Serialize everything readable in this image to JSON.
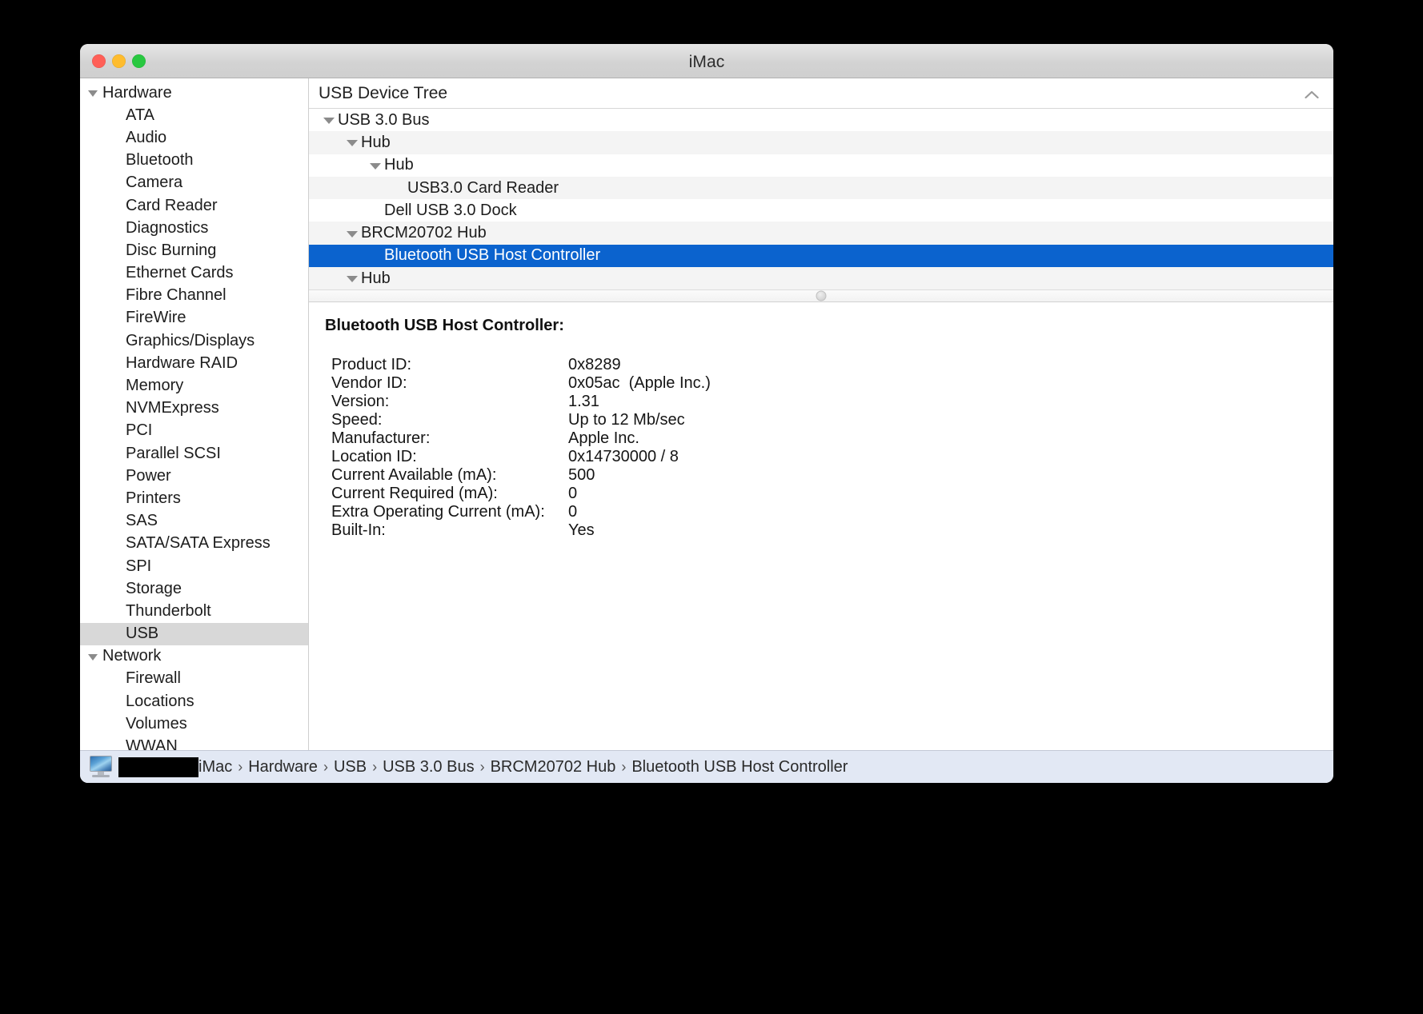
{
  "window": {
    "title": "iMac",
    "traffic_lights": [
      "close-button",
      "minimize-button",
      "zoom-button"
    ]
  },
  "sidebar": {
    "items": [
      {
        "label": "Hardware",
        "type": "group",
        "selected": false
      },
      {
        "label": "ATA",
        "type": "child",
        "selected": false
      },
      {
        "label": "Audio",
        "type": "child",
        "selected": false
      },
      {
        "label": "Bluetooth",
        "type": "child",
        "selected": false
      },
      {
        "label": "Camera",
        "type": "child",
        "selected": false
      },
      {
        "label": "Card Reader",
        "type": "child",
        "selected": false
      },
      {
        "label": "Diagnostics",
        "type": "child",
        "selected": false
      },
      {
        "label": "Disc Burning",
        "type": "child",
        "selected": false
      },
      {
        "label": "Ethernet Cards",
        "type": "child",
        "selected": false
      },
      {
        "label": "Fibre Channel",
        "type": "child",
        "selected": false
      },
      {
        "label": "FireWire",
        "type": "child",
        "selected": false
      },
      {
        "label": "Graphics/Displays",
        "type": "child",
        "selected": false
      },
      {
        "label": "Hardware RAID",
        "type": "child",
        "selected": false
      },
      {
        "label": "Memory",
        "type": "child",
        "selected": false
      },
      {
        "label": "NVMExpress",
        "type": "child",
        "selected": false
      },
      {
        "label": "PCI",
        "type": "child",
        "selected": false
      },
      {
        "label": "Parallel SCSI",
        "type": "child",
        "selected": false
      },
      {
        "label": "Power",
        "type": "child",
        "selected": false
      },
      {
        "label": "Printers",
        "type": "child",
        "selected": false
      },
      {
        "label": "SAS",
        "type": "child",
        "selected": false
      },
      {
        "label": "SATA/SATA Express",
        "type": "child",
        "selected": false
      },
      {
        "label": "SPI",
        "type": "child",
        "selected": false
      },
      {
        "label": "Storage",
        "type": "child",
        "selected": false
      },
      {
        "label": "Thunderbolt",
        "type": "child",
        "selected": false
      },
      {
        "label": "USB",
        "type": "child",
        "selected": true
      },
      {
        "label": "Network",
        "type": "group",
        "selected": false
      },
      {
        "label": "Firewall",
        "type": "child",
        "selected": false
      },
      {
        "label": "Locations",
        "type": "child",
        "selected": false
      },
      {
        "label": "Volumes",
        "type": "child",
        "selected": false
      },
      {
        "label": "WWAN",
        "type": "child",
        "selected": false
      }
    ]
  },
  "tree_panel": {
    "header_label": "USB Device Tree",
    "collapse_icon": "chevron-up-icon",
    "rows": [
      {
        "label": "USB 3.0 Bus",
        "depth": 0,
        "disclosure": true,
        "selected": false,
        "alt": false
      },
      {
        "label": "Hub",
        "depth": 1,
        "disclosure": true,
        "selected": false,
        "alt": true
      },
      {
        "label": "Hub",
        "depth": 2,
        "disclosure": true,
        "selected": false,
        "alt": false
      },
      {
        "label": "USB3.0 Card Reader",
        "depth": 3,
        "disclosure": false,
        "selected": false,
        "alt": true
      },
      {
        "label": "Dell USB 3.0 Dock",
        "depth": 2,
        "disclosure": false,
        "selected": false,
        "alt": false
      },
      {
        "label": "BRCM20702 Hub",
        "depth": 1,
        "disclosure": true,
        "selected": false,
        "alt": true
      },
      {
        "label": "Bluetooth USB Host Controller",
        "depth": 2,
        "disclosure": false,
        "selected": true,
        "alt": false
      },
      {
        "label": "Hub",
        "depth": 1,
        "disclosure": true,
        "selected": false,
        "alt": true
      }
    ]
  },
  "detail": {
    "title": "Bluetooth USB Host Controller:",
    "properties": [
      {
        "key": "Product ID:",
        "value": "0x8289"
      },
      {
        "key": "Vendor ID:",
        "value": "0x05ac  (Apple Inc.)"
      },
      {
        "key": "Version:",
        "value": "1.31"
      },
      {
        "key": "Speed:",
        "value": "Up to 12 Mb/sec"
      },
      {
        "key": "Manufacturer:",
        "value": "Apple Inc."
      },
      {
        "key": "Location ID:",
        "value": "0x14730000 / 8"
      },
      {
        "key": "Current Available (mA):",
        "value": "500"
      },
      {
        "key": "Current Required (mA):",
        "value": "0"
      },
      {
        "key": "Extra Operating Current (mA):",
        "value": "0"
      },
      {
        "key": "Built-In:",
        "value": "Yes"
      }
    ]
  },
  "statusbar": {
    "device_icon": "imac-computer-icon",
    "redacted_label": "",
    "separator": "›",
    "breadcrumbs": [
      "iMac",
      "Hardware",
      "USB",
      "USB 3.0 Bus",
      "BRCM20702 Hub",
      "Bluetooth USB Host Controller"
    ]
  },
  "colors": {
    "selection_blue": "#0b63ce",
    "sidebar_selection_gray": "#d8d8d8",
    "statusbar_bg": "#e2e8f4",
    "alt_row": "#f4f4f4"
  }
}
